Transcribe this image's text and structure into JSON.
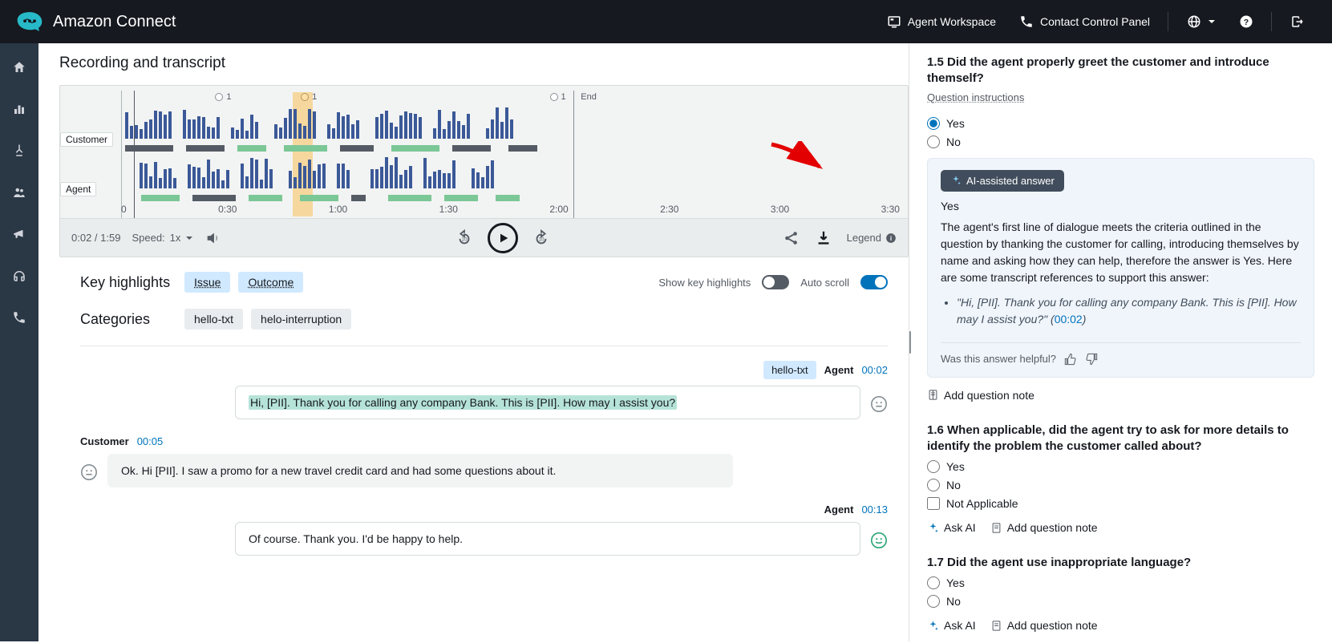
{
  "brand": "Amazon Connect",
  "topnav": {
    "agent_workspace": "Agent Workspace",
    "ccp": "Contact Control Panel"
  },
  "card_title": "Recording and transcript",
  "waveform": {
    "cust_label": "Customer",
    "agent_label": "Agent",
    "markers": [
      "1",
      "1",
      "1"
    ],
    "end_label": "End",
    "ticks": [
      "0",
      "0:30",
      "1:00",
      "1:30",
      "2:00",
      "2:30",
      "3:00",
      "3:30"
    ]
  },
  "playbar": {
    "time": "0:02 / 1:59",
    "speed_label": "Speed:",
    "speed_value": "1x",
    "legend": "Legend"
  },
  "highlights": {
    "label": "Key highlights",
    "issue": "Issue",
    "outcome": "Outcome",
    "show_label": "Show key highlights",
    "autoscroll_label": "Auto scroll",
    "cat_label": "Categories",
    "cat1": "hello-txt",
    "cat2": "helo-interruption"
  },
  "transcript": [
    {
      "who": "Agent",
      "ts": "00:02",
      "tag": "hello-txt",
      "text": "Hi, [PII]. Thank you for calling any company Bank. This is [PII]. How may I assist you?",
      "sentiment": "neutral",
      "highlighted": true
    },
    {
      "who": "Customer",
      "ts": "00:05",
      "text": "Ok. Hi [PII]. I saw a promo for a new travel credit card and had some questions about it.",
      "sentiment": "neutral"
    },
    {
      "who": "Agent",
      "ts": "00:13",
      "text": "Of course. Thank you. I'd be happy to help.",
      "sentiment": "positive"
    }
  ],
  "ai_assisted_label": "AI-assisted answer",
  "ai_feedback_label": "Was this answer helpful?",
  "ask_ai_label": "Ask AI",
  "add_note_label": "Add question note",
  "instructions_label": "Question instructions",
  "opt_yes": "Yes",
  "opt_no": "No",
  "opt_na": "Not Applicable",
  "questions": {
    "q15": {
      "title": "1.5 Did the agent properly greet the customer and introduce themself?",
      "ai": {
        "answer": "Yes",
        "reason": "The agent's first line of dialogue meets the criteria outlined in the question by thanking the customer for calling, introducing themselves by name and asking how they can help, therefore the answer is Yes. Here are some transcript references to support this answer:",
        "quote": "\"Hi, [PII]. Thank you for calling any company Bank. This is [PII]. How may I assist you?\"",
        "quote_ts": "00:02"
      }
    },
    "q16": {
      "title": "1.6 When applicable, did the agent try to ask for more details to identify the problem the customer called about?"
    },
    "q17": {
      "title": "1.7 Did the agent use inappropriate language?"
    }
  }
}
